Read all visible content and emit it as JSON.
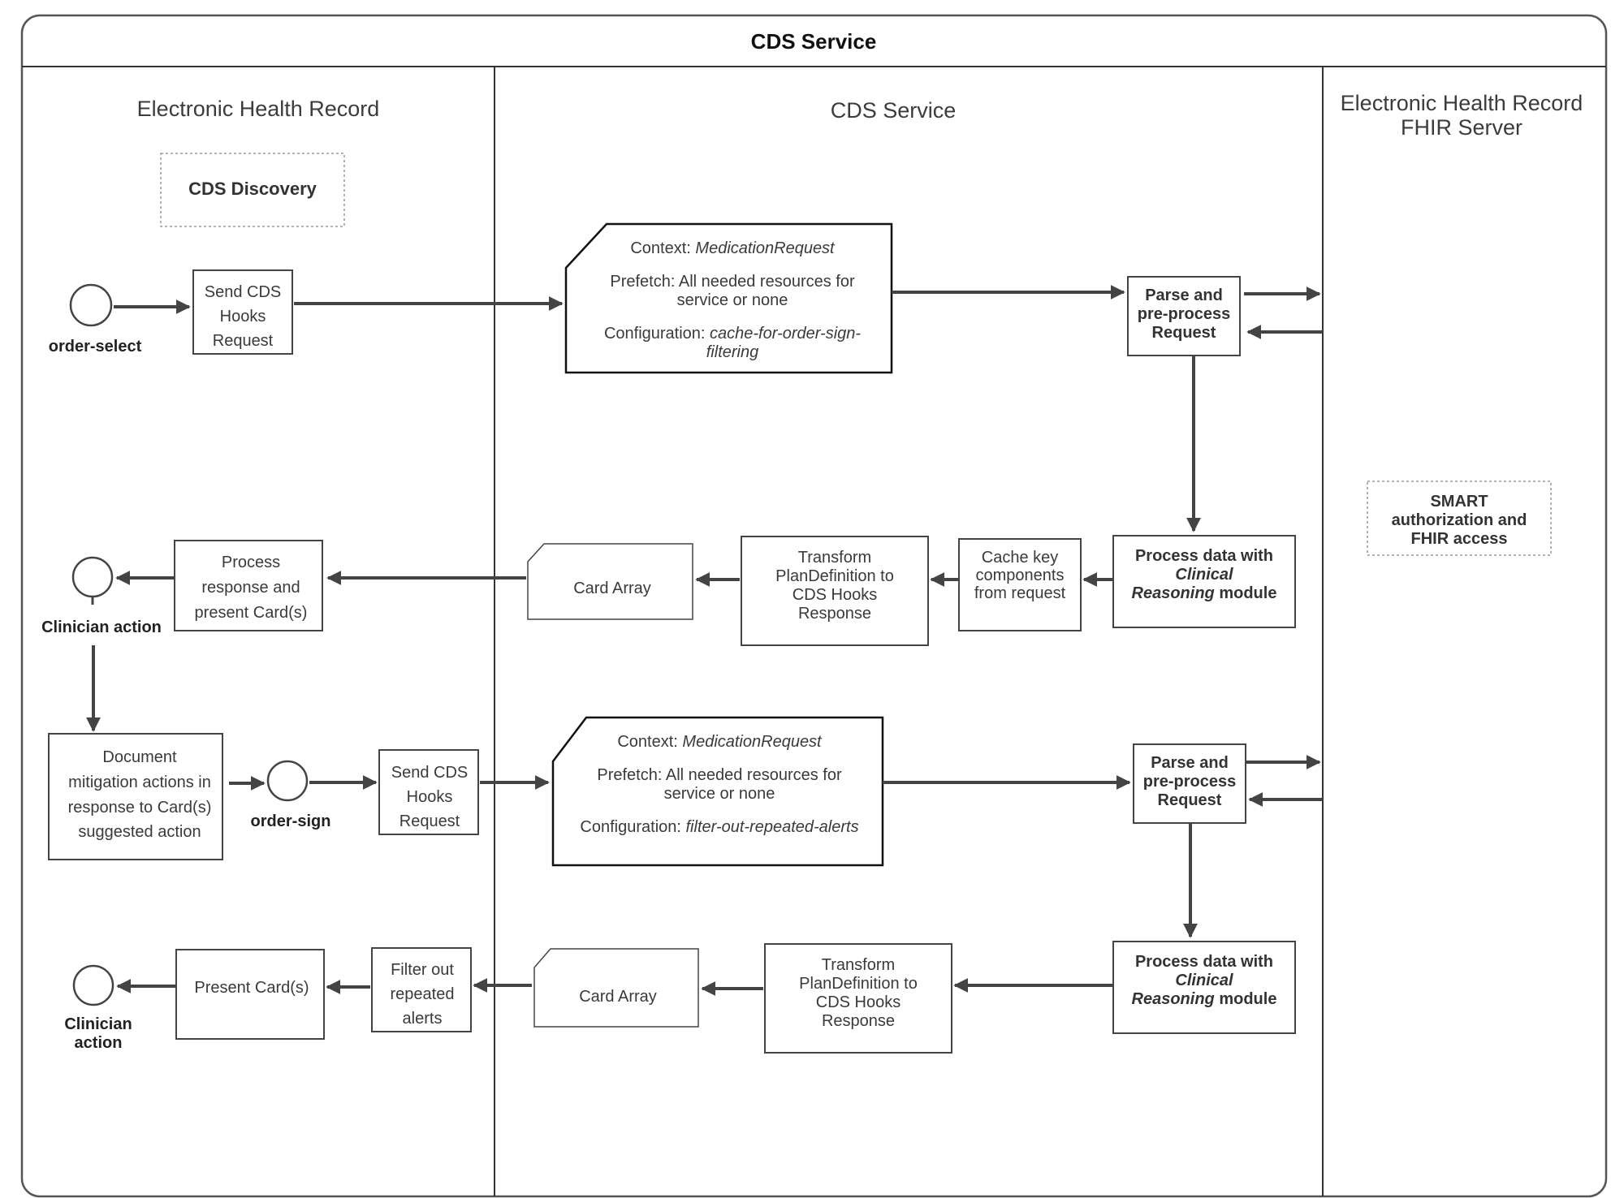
{
  "diagram": {
    "title": "CDS Service",
    "lanes": [
      {
        "name": "Electronic Health Record",
        "lines": [
          "Electronic Health Record"
        ]
      },
      {
        "name": "CDS Service",
        "lines": [
          "CDS Service"
        ]
      },
      {
        "name": "Electronic Health Record FHIR Server",
        "lines": [
          "Electronic Health Record",
          "FHIR Server"
        ]
      }
    ],
    "annotations": {
      "cds_discovery": "CDS Discovery",
      "smart_access": [
        "SMART",
        "authorization and",
        "FHIR access"
      ]
    },
    "events": {
      "order_select": "order-select",
      "clinician_action_1": "Clinician action",
      "order_sign": "order-sign",
      "clinician_action_2": [
        "Clinician",
        "action"
      ]
    },
    "flow1": {
      "send_request": [
        "Send CDS",
        "Hooks",
        "Request"
      ],
      "request_doc": {
        "context_label": "Context: ",
        "context_value": "MedicationRequest",
        "prefetch": [
          "Prefetch: All needed resources for",
          "service or none"
        ],
        "config_label": "Configuration: ",
        "config_value_1": "cache-for-order-sign-",
        "config_value_2": "filtering"
      },
      "parse": [
        "Parse and",
        "pre-process",
        "Request"
      ],
      "process": {
        "line1": "Process data with",
        "line2": "Clinical",
        "line3_italic": "Reasoning",
        "line3_rest": " module"
      },
      "cache": [
        "Cache key",
        "components",
        "from request"
      ],
      "transform": [
        "Transform",
        "PlanDefinition to",
        "CDS Hooks",
        "Response"
      ],
      "card_array": "Card Array",
      "present": [
        "Process",
        "response and",
        "present Card(s)"
      ]
    },
    "document_mitigation": [
      "Document",
      "mitigation actions in",
      "response to Card(s)",
      "suggested action"
    ],
    "flow2": {
      "send_request": [
        "Send CDS",
        "Hooks",
        "Request"
      ],
      "request_doc": {
        "context_label": "Context: ",
        "context_value": "MedicationRequest",
        "prefetch": [
          "Prefetch: All needed resources for",
          "service or none"
        ],
        "config_label": "Configuration: ",
        "config_value": "filter-out-repeated-alerts"
      },
      "parse": [
        "Parse and",
        "pre-process",
        "Request"
      ],
      "process": {
        "line1": "Process data with",
        "line2": "Clinical",
        "line3_italic": "Reasoning",
        "line3_rest": " module"
      },
      "transform": [
        "Transform",
        "PlanDefinition to",
        "CDS Hooks",
        "Response"
      ],
      "card_array": "Card Array",
      "filter": [
        "Filter out",
        "repeated",
        "alerts"
      ],
      "present": "Present Card(s)"
    },
    "colors": {
      "stroke": "#444444",
      "text": "#3a3a3a",
      "dashed": "#999999"
    }
  }
}
